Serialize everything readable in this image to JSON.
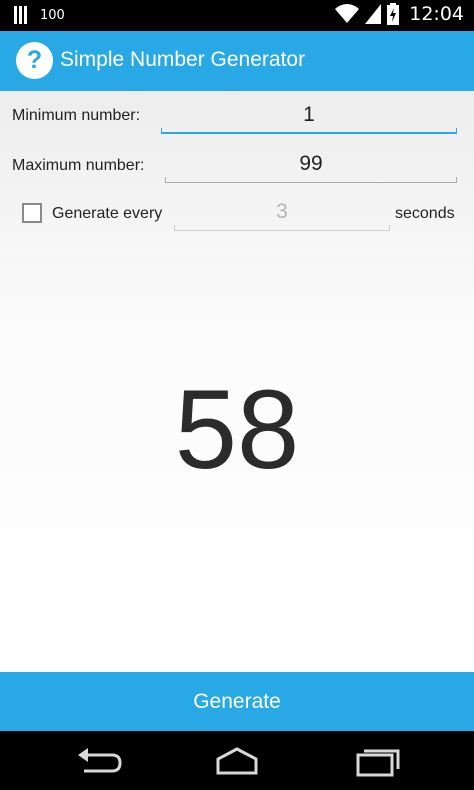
{
  "status_bar": {
    "notification_count": "100",
    "time": "12:04",
    "icons": [
      "barcode-icon",
      "wifi-icon",
      "signal-icon",
      "battery-charging-icon"
    ]
  },
  "action_bar": {
    "icon_glyph": "?",
    "title": "Simple Number Generator"
  },
  "form": {
    "min_label": "Minimum number:",
    "min_value": "1",
    "max_label": "Maximum number:",
    "max_value": "99",
    "auto_label": "Generate every",
    "auto_placeholder": "3",
    "auto_checked": false,
    "seconds_label": "seconds"
  },
  "result": "58",
  "generate_label": "Generate",
  "nav": [
    "back-icon",
    "home-icon",
    "recent-apps-icon"
  ],
  "colors": {
    "accent": "#29a8e6",
    "status_bar": "#000000",
    "result_text": "#2b2b2b"
  }
}
